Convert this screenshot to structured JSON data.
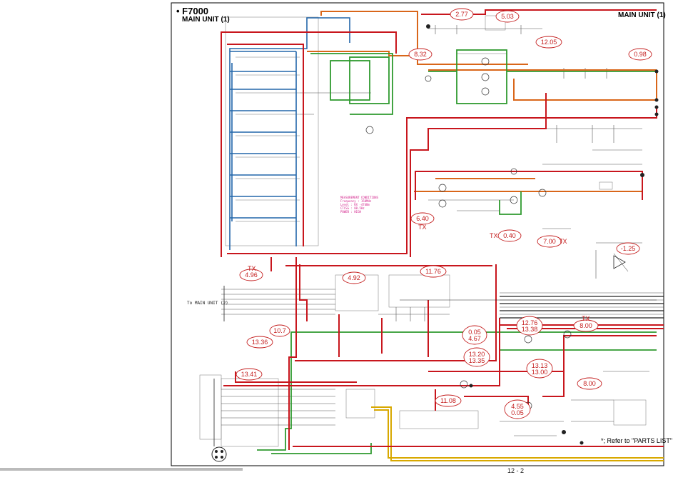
{
  "header": {
    "model": "• F7000",
    "unit_left": "MAIN UNIT (1)",
    "unit_right": "MAIN UNIT (1)"
  },
  "labels": {
    "to_main_unit": "To MAIN UNIT (2)",
    "parts_note": "*; Refer to \"PARTS LIST\"",
    "page_number": "12 - 2"
  },
  "measurement_note": "MEASUREMENT CONDITIONS\nFrequency : 150MHz\nLevel : RX -47dBm\nCTCSS : 88.5Hz\nPOWER : HIGH",
  "voltage_readings": [
    {
      "id": "v1",
      "text": "2.77"
    },
    {
      "id": "v2",
      "text": "5.03"
    },
    {
      "id": "v3",
      "text": "12.05"
    },
    {
      "id": "v4",
      "text": "8.32"
    },
    {
      "id": "v5",
      "text": "0.98"
    },
    {
      "id": "v6",
      "text": "6.40"
    },
    {
      "id": "v7",
      "text": "0.40"
    },
    {
      "id": "v8",
      "text": "7.00"
    },
    {
      "id": "v9",
      "text": "-1.25"
    },
    {
      "id": "v10",
      "text": "4.96"
    },
    {
      "id": "v11",
      "text": "4.92"
    },
    {
      "id": "v12",
      "text": "11.76"
    },
    {
      "id": "v13",
      "text": "10.7"
    },
    {
      "id": "v14",
      "text": "13.36"
    },
    {
      "id": "v15",
      "text": "0.05\n4.67"
    },
    {
      "id": "v16",
      "text": "12.76\n13.38"
    },
    {
      "id": "v17",
      "text": "8.00"
    },
    {
      "id": "v18",
      "text": "13.20\n13.35"
    },
    {
      "id": "v19",
      "text": "13.13\n13.00"
    },
    {
      "id": "v20",
      "text": "13.41"
    },
    {
      "id": "v21",
      "text": "8.00"
    },
    {
      "id": "v22",
      "text": "11.08"
    },
    {
      "id": "v23",
      "text": "4.55\n0.05"
    }
  ],
  "tx_tags": {
    "t1": "TX",
    "t2": "TX",
    "t3": "TX",
    "t4": "TX",
    "t5": "TX"
  },
  "trace_colors": {
    "dc_supply": "#c8161d",
    "rx_signal": "#d9661a",
    "audio": "#2f9a2f",
    "control": "#2266aa",
    "aux": "#d8a800",
    "component": "#333333"
  }
}
